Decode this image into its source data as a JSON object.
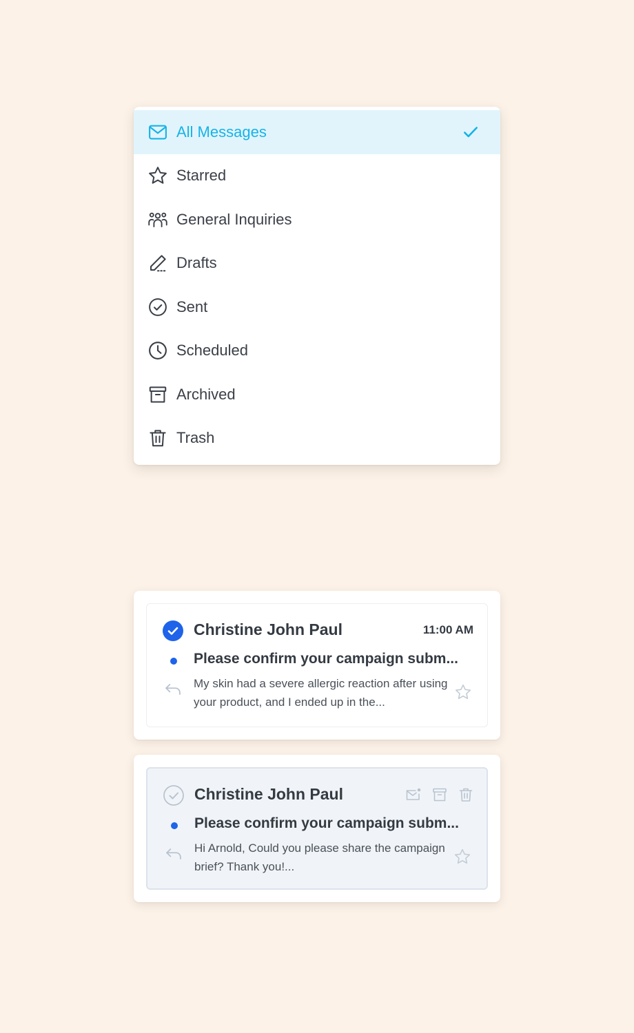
{
  "menu": {
    "items": [
      {
        "label": "All Messages",
        "icon": "mail-icon",
        "active": true
      },
      {
        "label": "Starred",
        "icon": "star-icon"
      },
      {
        "label": "General Inquiries",
        "icon": "group-icon"
      },
      {
        "label": "Drafts",
        "icon": "pencil-icon"
      },
      {
        "label": "Sent",
        "icon": "check-circle-icon"
      },
      {
        "label": "Scheduled",
        "icon": "clock-icon"
      },
      {
        "label": "Archived",
        "icon": "archive-icon"
      },
      {
        "label": "Trash",
        "icon": "trash-icon"
      }
    ]
  },
  "messages": [
    {
      "sender": "Christine John Paul",
      "time": "11:00 AM",
      "subject": "Please confirm your campaign subm...",
      "preview": "My skin had a severe allergic reaction after using your product, and I ended up in the...",
      "selected": true,
      "unread": true
    },
    {
      "sender": "Christine John Paul",
      "subject": "Please confirm your campaign subm...",
      "preview": "Hi Arnold, Could you please share the campaign brief? Thank you!...",
      "selected": false,
      "unread": true,
      "hovered": true
    }
  ],
  "colors": {
    "background": "#fcf2e8",
    "accent": "#16b3e7",
    "active_bg": "#e1f4fc",
    "primary_blue": "#1e63e9",
    "text": "#3a3f47",
    "muted_icon": "#b9c3cf"
  }
}
